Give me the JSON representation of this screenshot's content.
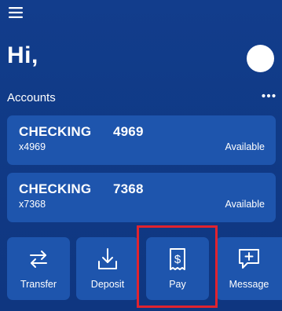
{
  "header": {
    "menu_icon": "hamburger-menu-icon",
    "greeting": "Hi,",
    "avatar_icon": "profile-avatar"
  },
  "accounts": {
    "section_label": "Accounts",
    "more_icon": "more-horizontal-icon",
    "items": [
      {
        "name": "CHECKING",
        "balance": "4969",
        "masked_number": "x4969",
        "status": "Available"
      },
      {
        "name": "CHECKING",
        "balance": "7368",
        "masked_number": "x7368",
        "status": "Available"
      }
    ]
  },
  "actions": [
    {
      "label": "Transfer",
      "icon": "transfer-arrows-icon"
    },
    {
      "label": "Deposit",
      "icon": "download-tray-icon"
    },
    {
      "label": "Pay",
      "icon": "bill-dollar-icon"
    },
    {
      "label": "Message",
      "icon": "chat-plus-icon"
    }
  ],
  "colors": {
    "background": "#103a86",
    "card": "#1e55ad",
    "text": "#ffffff",
    "highlight": "#e0232f"
  }
}
